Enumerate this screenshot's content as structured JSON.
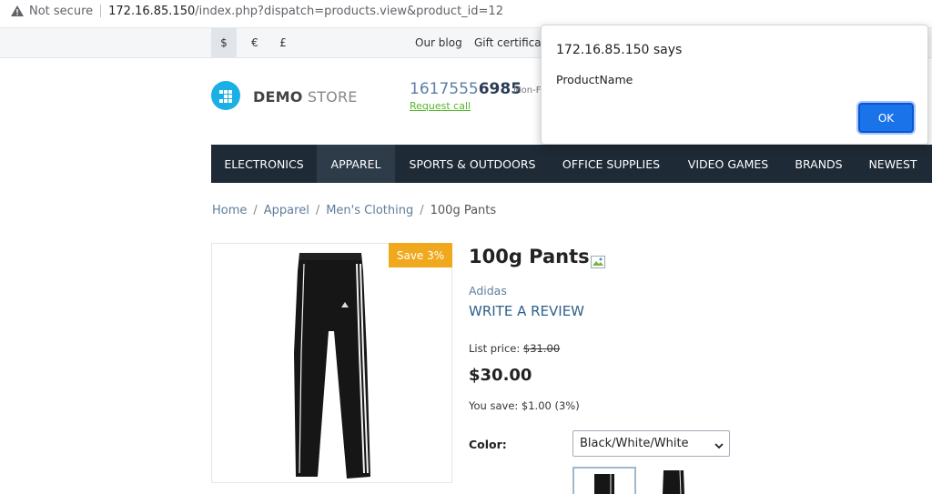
{
  "browser": {
    "security_label": "Not secure",
    "url_host": "172.16.85.150",
    "url_path": "/index.php?dispatch=products.view&product_id=12"
  },
  "top_strip": {
    "currencies": [
      "$",
      "€",
      "£"
    ],
    "active_currency": "$",
    "links": [
      "Our blog",
      "Gift certificat"
    ]
  },
  "header": {
    "logo_bold": "DEMO",
    "logo_light": " STORE",
    "phone_prefix": "1617555",
    "phone_bold": "6985",
    "phone_hours": "Mon-F",
    "request_call": "Request call"
  },
  "nav": {
    "items": [
      "ELECTRONICS",
      "APPAREL",
      "SPORTS & OUTDOORS",
      "OFFICE SUPPLIES",
      "VIDEO GAMES",
      "BRANDS",
      "NEWEST"
    ],
    "active": "APPAREL"
  },
  "breadcrumb": {
    "items": [
      "Home",
      "Apparel",
      "Men's Clothing"
    ],
    "current": "100g Pants",
    "separator": "/"
  },
  "product": {
    "save_badge": "Save 3%",
    "title": "100g Pants",
    "brand": "Adidas",
    "write_review": "WRITE A REVIEW",
    "list_price_label": "List price:",
    "list_price_value": "$31.00",
    "price": "$30.00",
    "you_save": "You save: $1.00 (3%)",
    "color_label": "Color:",
    "color_value": "Black/White/White"
  },
  "dialog": {
    "title": "172.16.85.150 says",
    "message": "ProductName",
    "ok_label": "OK"
  },
  "colors": {
    "accent_blue": "#1a73e8",
    "nav_bg": "#1e2a36",
    "badge_orange": "#f0a81c",
    "logo_blue": "#1ab0e6",
    "link_green": "#55b62b"
  },
  "icons": {
    "security": "warning-triangle-icon",
    "logo": "store-logo-icon",
    "select": "chevron-down-icon",
    "broken_image": "broken-image-icon"
  }
}
